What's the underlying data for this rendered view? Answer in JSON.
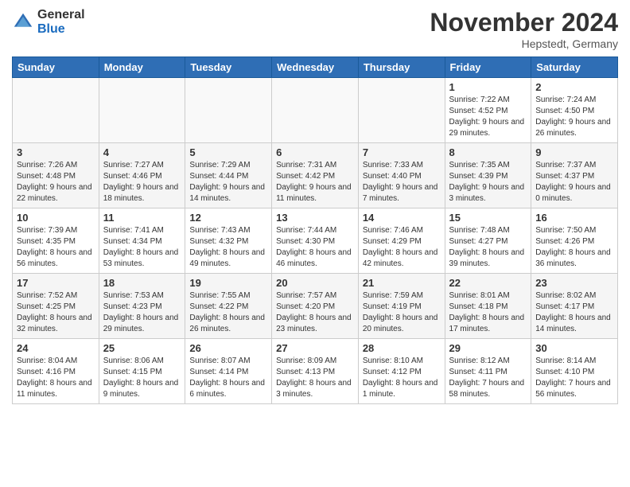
{
  "logo": {
    "general": "General",
    "blue": "Blue"
  },
  "title": "November 2024",
  "location": "Hepstedt, Germany",
  "headers": [
    "Sunday",
    "Monday",
    "Tuesday",
    "Wednesday",
    "Thursday",
    "Friday",
    "Saturday"
  ],
  "weeks": [
    [
      {
        "day": "",
        "info": ""
      },
      {
        "day": "",
        "info": ""
      },
      {
        "day": "",
        "info": ""
      },
      {
        "day": "",
        "info": ""
      },
      {
        "day": "",
        "info": ""
      },
      {
        "day": "1",
        "info": "Sunrise: 7:22 AM\nSunset: 4:52 PM\nDaylight: 9 hours and 29 minutes."
      },
      {
        "day": "2",
        "info": "Sunrise: 7:24 AM\nSunset: 4:50 PM\nDaylight: 9 hours and 26 minutes."
      }
    ],
    [
      {
        "day": "3",
        "info": "Sunrise: 7:26 AM\nSunset: 4:48 PM\nDaylight: 9 hours and 22 minutes."
      },
      {
        "day": "4",
        "info": "Sunrise: 7:27 AM\nSunset: 4:46 PM\nDaylight: 9 hours and 18 minutes."
      },
      {
        "day": "5",
        "info": "Sunrise: 7:29 AM\nSunset: 4:44 PM\nDaylight: 9 hours and 14 minutes."
      },
      {
        "day": "6",
        "info": "Sunrise: 7:31 AM\nSunset: 4:42 PM\nDaylight: 9 hours and 11 minutes."
      },
      {
        "day": "7",
        "info": "Sunrise: 7:33 AM\nSunset: 4:40 PM\nDaylight: 9 hours and 7 minutes."
      },
      {
        "day": "8",
        "info": "Sunrise: 7:35 AM\nSunset: 4:39 PM\nDaylight: 9 hours and 3 minutes."
      },
      {
        "day": "9",
        "info": "Sunrise: 7:37 AM\nSunset: 4:37 PM\nDaylight: 9 hours and 0 minutes."
      }
    ],
    [
      {
        "day": "10",
        "info": "Sunrise: 7:39 AM\nSunset: 4:35 PM\nDaylight: 8 hours and 56 minutes."
      },
      {
        "day": "11",
        "info": "Sunrise: 7:41 AM\nSunset: 4:34 PM\nDaylight: 8 hours and 53 minutes."
      },
      {
        "day": "12",
        "info": "Sunrise: 7:43 AM\nSunset: 4:32 PM\nDaylight: 8 hours and 49 minutes."
      },
      {
        "day": "13",
        "info": "Sunrise: 7:44 AM\nSunset: 4:30 PM\nDaylight: 8 hours and 46 minutes."
      },
      {
        "day": "14",
        "info": "Sunrise: 7:46 AM\nSunset: 4:29 PM\nDaylight: 8 hours and 42 minutes."
      },
      {
        "day": "15",
        "info": "Sunrise: 7:48 AM\nSunset: 4:27 PM\nDaylight: 8 hours and 39 minutes."
      },
      {
        "day": "16",
        "info": "Sunrise: 7:50 AM\nSunset: 4:26 PM\nDaylight: 8 hours and 36 minutes."
      }
    ],
    [
      {
        "day": "17",
        "info": "Sunrise: 7:52 AM\nSunset: 4:25 PM\nDaylight: 8 hours and 32 minutes."
      },
      {
        "day": "18",
        "info": "Sunrise: 7:53 AM\nSunset: 4:23 PM\nDaylight: 8 hours and 29 minutes."
      },
      {
        "day": "19",
        "info": "Sunrise: 7:55 AM\nSunset: 4:22 PM\nDaylight: 8 hours and 26 minutes."
      },
      {
        "day": "20",
        "info": "Sunrise: 7:57 AM\nSunset: 4:20 PM\nDaylight: 8 hours and 23 minutes."
      },
      {
        "day": "21",
        "info": "Sunrise: 7:59 AM\nSunset: 4:19 PM\nDaylight: 8 hours and 20 minutes."
      },
      {
        "day": "22",
        "info": "Sunrise: 8:01 AM\nSunset: 4:18 PM\nDaylight: 8 hours and 17 minutes."
      },
      {
        "day": "23",
        "info": "Sunrise: 8:02 AM\nSunset: 4:17 PM\nDaylight: 8 hours and 14 minutes."
      }
    ],
    [
      {
        "day": "24",
        "info": "Sunrise: 8:04 AM\nSunset: 4:16 PM\nDaylight: 8 hours and 11 minutes."
      },
      {
        "day": "25",
        "info": "Sunrise: 8:06 AM\nSunset: 4:15 PM\nDaylight: 8 hours and 9 minutes."
      },
      {
        "day": "26",
        "info": "Sunrise: 8:07 AM\nSunset: 4:14 PM\nDaylight: 8 hours and 6 minutes."
      },
      {
        "day": "27",
        "info": "Sunrise: 8:09 AM\nSunset: 4:13 PM\nDaylight: 8 hours and 3 minutes."
      },
      {
        "day": "28",
        "info": "Sunrise: 8:10 AM\nSunset: 4:12 PM\nDaylight: 8 hours and 1 minute."
      },
      {
        "day": "29",
        "info": "Sunrise: 8:12 AM\nSunset: 4:11 PM\nDaylight: 7 hours and 58 minutes."
      },
      {
        "day": "30",
        "info": "Sunrise: 8:14 AM\nSunset: 4:10 PM\nDaylight: 7 hours and 56 minutes."
      }
    ]
  ]
}
